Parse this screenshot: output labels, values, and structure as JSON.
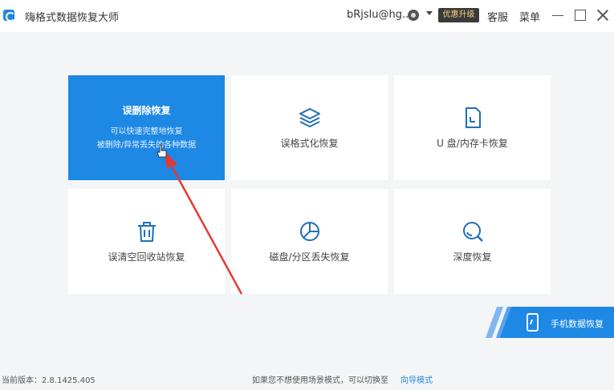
{
  "titlebar": {
    "app_title": "嗨格式数据恢复大师",
    "user_name": "bRjslu@hg...",
    "upgrade_label": "优惠升级",
    "service_label": "客服",
    "menu_label": "菜单"
  },
  "cards": [
    {
      "label": "误删除恢复",
      "desc_line1": "可以快速完整地恢复",
      "desc_line2": "被删除/异常丢失的各种数据",
      "icon": "none",
      "active": true
    },
    {
      "label": "误格式化恢复",
      "icon": "layers-icon"
    },
    {
      "label": "U 盘/内存卡恢复",
      "icon": "sd-card-icon"
    },
    {
      "label": "误清空回收站恢复",
      "icon": "trash-icon"
    },
    {
      "label": "磁盘/分区丢失恢复",
      "icon": "pie-chart-icon"
    },
    {
      "label": "深度恢复",
      "icon": "deep-search-icon"
    }
  ],
  "mobile_banner": {
    "label": "手机数据恢复",
    "icon": "phone-icon"
  },
  "footer": {
    "version": "当前版本：2.8.1425.405",
    "hint": "如果您不想使用场景模式，可以切换至",
    "wizard_link": "向导模式"
  },
  "colors": {
    "accent": "#1e88e5",
    "background": "#f4f5f7",
    "card": "#ffffff",
    "annotation_arrow": "#e53935"
  }
}
